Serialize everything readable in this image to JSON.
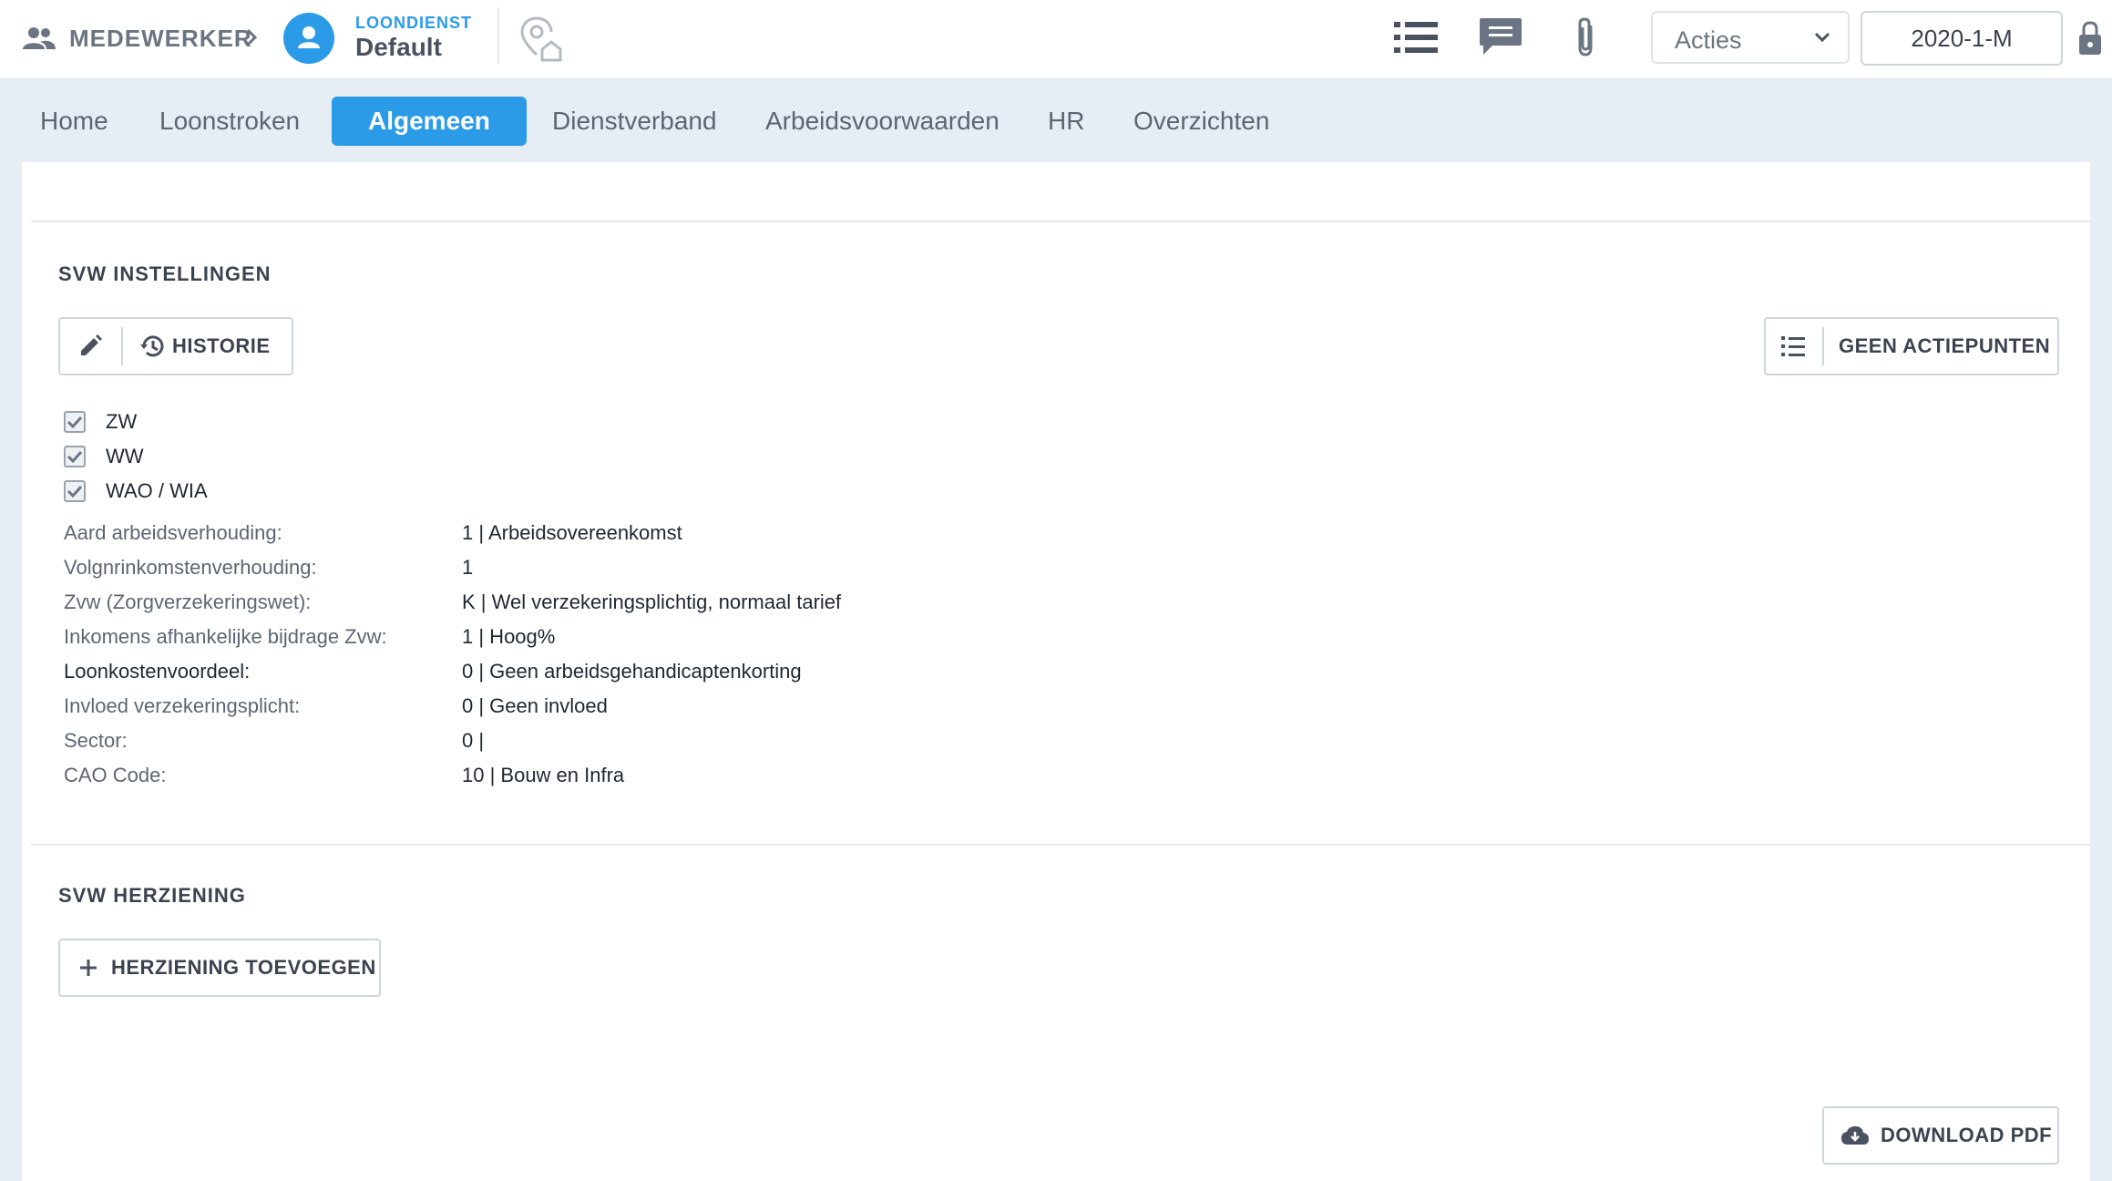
{
  "header": {
    "breadcrumb_label": "MEDEWERKER",
    "org_sub": "LOONDIENST",
    "org_name": "Default",
    "actions_select": "Acties",
    "period": "2020-1-M"
  },
  "tabs": [
    {
      "label": "Home"
    },
    {
      "label": "Loonstroken"
    },
    {
      "label": "Algemeen",
      "active": true
    },
    {
      "label": "Dienstverband"
    },
    {
      "label": "Arbeidsvoorwaarden"
    },
    {
      "label": "HR"
    },
    {
      "label": "Overzichten"
    }
  ],
  "svw_settings": {
    "title": "SVW INSTELLINGEN",
    "history_label": "HISTORIE",
    "action_points_label": "GEEN ACTIEPUNTEN",
    "checkboxes": [
      {
        "label": "ZW",
        "checked": true
      },
      {
        "label": "WW",
        "checked": true
      },
      {
        "label": "WAO / WIA",
        "checked": true
      }
    ],
    "fields": [
      {
        "label": "Aard arbeidsverhouding:",
        "value": "1 | Arbeidsovereenkomst"
      },
      {
        "label": "Volgnrinkomstenverhouding:",
        "value": "1"
      },
      {
        "label": "Zvw (Zorgverzekeringswet):",
        "value": "K | Wel verzekeringsplichtig, normaal tarief"
      },
      {
        "label": "Inkomens afhankelijke bijdrage Zvw:",
        "value": "1 | Hoog%"
      },
      {
        "label": "Loonkostenvoordeel:",
        "value": "0 | Geen arbeidsgehandicaptenkorting"
      },
      {
        "label": "Invloed verzekeringsplicht:",
        "value": "0 | Geen invloed"
      },
      {
        "label": "Sector:",
        "value": "0 |"
      },
      {
        "label": "CAO Code:",
        "value": "10 | Bouw en Infra"
      }
    ]
  },
  "svw_revision": {
    "title": "SVW HERZIENING",
    "add_label": "HERZIENING TOEVOEGEN"
  },
  "download_label": "DOWNLOAD PDF",
  "colors": {
    "accent": "#2b9be8",
    "background": "#e6edf5",
    "text_muted": "#5c6673"
  }
}
